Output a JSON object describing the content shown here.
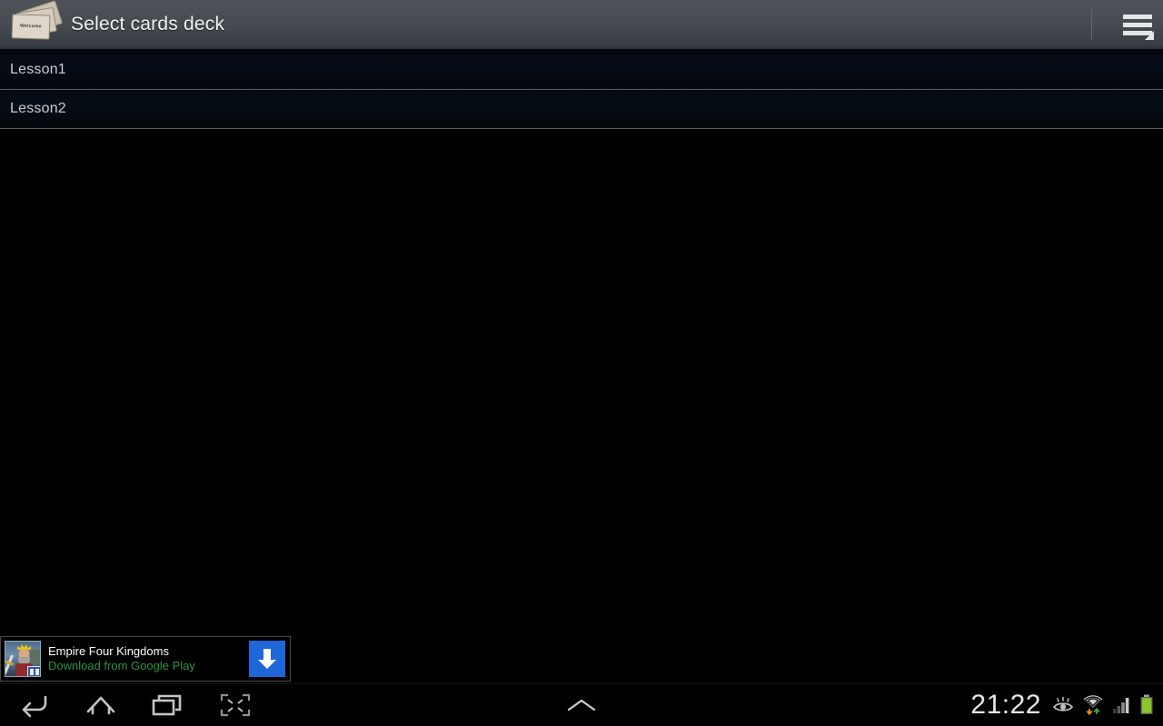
{
  "actionbar": {
    "title": "Select cards deck",
    "app_icon": "cards-deck-icon",
    "card_front_label": "Welcome",
    "overflow_icon": "overflow-menu-icon"
  },
  "list": {
    "items": [
      {
        "label": "Lesson1"
      },
      {
        "label": "Lesson2"
      }
    ]
  },
  "ad": {
    "icon": "empire-four-kingdoms-app-icon",
    "title": "Empire Four Kingdoms",
    "subtitle": "Download from Google Play",
    "cta_icon": "download-arrow-icon",
    "cta_color": "#1f66d9",
    "subtitle_color": "#2f9246"
  },
  "navbar": {
    "back_icon": "back-arrow-icon",
    "home_icon": "home-icon",
    "recents_icon": "recent-apps-icon",
    "screenshot_icon": "shrink-screen-icon",
    "chevron_icon": "chevron-up-icon",
    "status": {
      "clock": "21:22",
      "eye_icon": "eye-visibility-icon",
      "wifi_icon": "wifi-data-transfer-icon",
      "signal_icon": "cellular-signal-icon",
      "battery_icon": "battery-full-icon",
      "battery_color": "#8ac62a"
    }
  }
}
